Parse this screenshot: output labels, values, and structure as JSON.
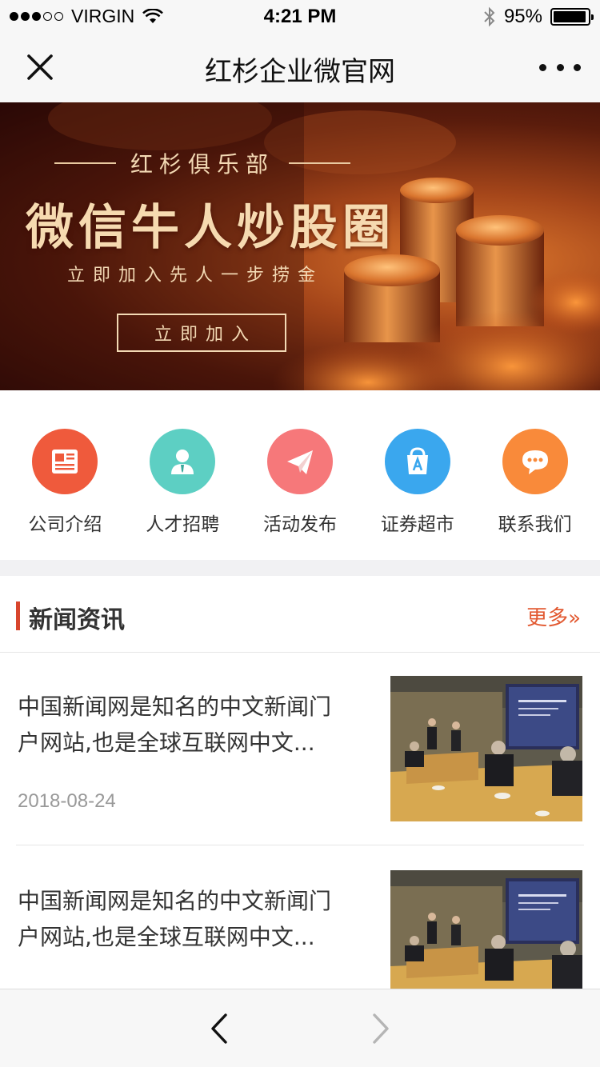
{
  "status_bar": {
    "carrier": "VIRGIN",
    "time": "4:21 PM",
    "battery_text": "95%",
    "battery_level": 0.95
  },
  "nav": {
    "title": "红杉企业微官网",
    "close_icon": "close-icon",
    "more_icon": "more-icon"
  },
  "banner": {
    "subtitle": "红杉俱乐部",
    "title": "微信牛人炒股圈",
    "slogan": "立即加入先人一步捞金",
    "button_label": "立即加入"
  },
  "quick_menu": {
    "items": [
      {
        "label": "公司介绍",
        "icon": "newspaper-icon",
        "color": "#ef5a3c"
      },
      {
        "label": "人才招聘",
        "icon": "user-icon",
        "color": "#5dcfc3"
      },
      {
        "label": "活动发布",
        "icon": "paper-plane-icon",
        "color": "#f6787a"
      },
      {
        "label": "证券超市",
        "icon": "shopping-bag-icon",
        "color": "#3aa7ee"
      },
      {
        "label": "联系我们",
        "icon": "chat-bubble-icon",
        "color": "#f98a3a"
      }
    ]
  },
  "news": {
    "section_title": "新闻资讯",
    "more_label": "更多",
    "items": [
      {
        "title_line1": "中国新闻网是知名的中文新闻门",
        "title_line2": "户网站,也是全球互联网中文...",
        "date": "2018-08-24"
      },
      {
        "title_line1": "中国新闻网是知名的中文新闻门",
        "title_line2": "户网站,也是全球互联网中文..."
      }
    ]
  },
  "colors": {
    "accent": "#e25a32",
    "section_bar": "#d8452d",
    "banner_text": "#f6dab0"
  },
  "toolbar": {
    "back_icon": "chevron-left-icon",
    "forward_icon": "chevron-right-icon"
  }
}
